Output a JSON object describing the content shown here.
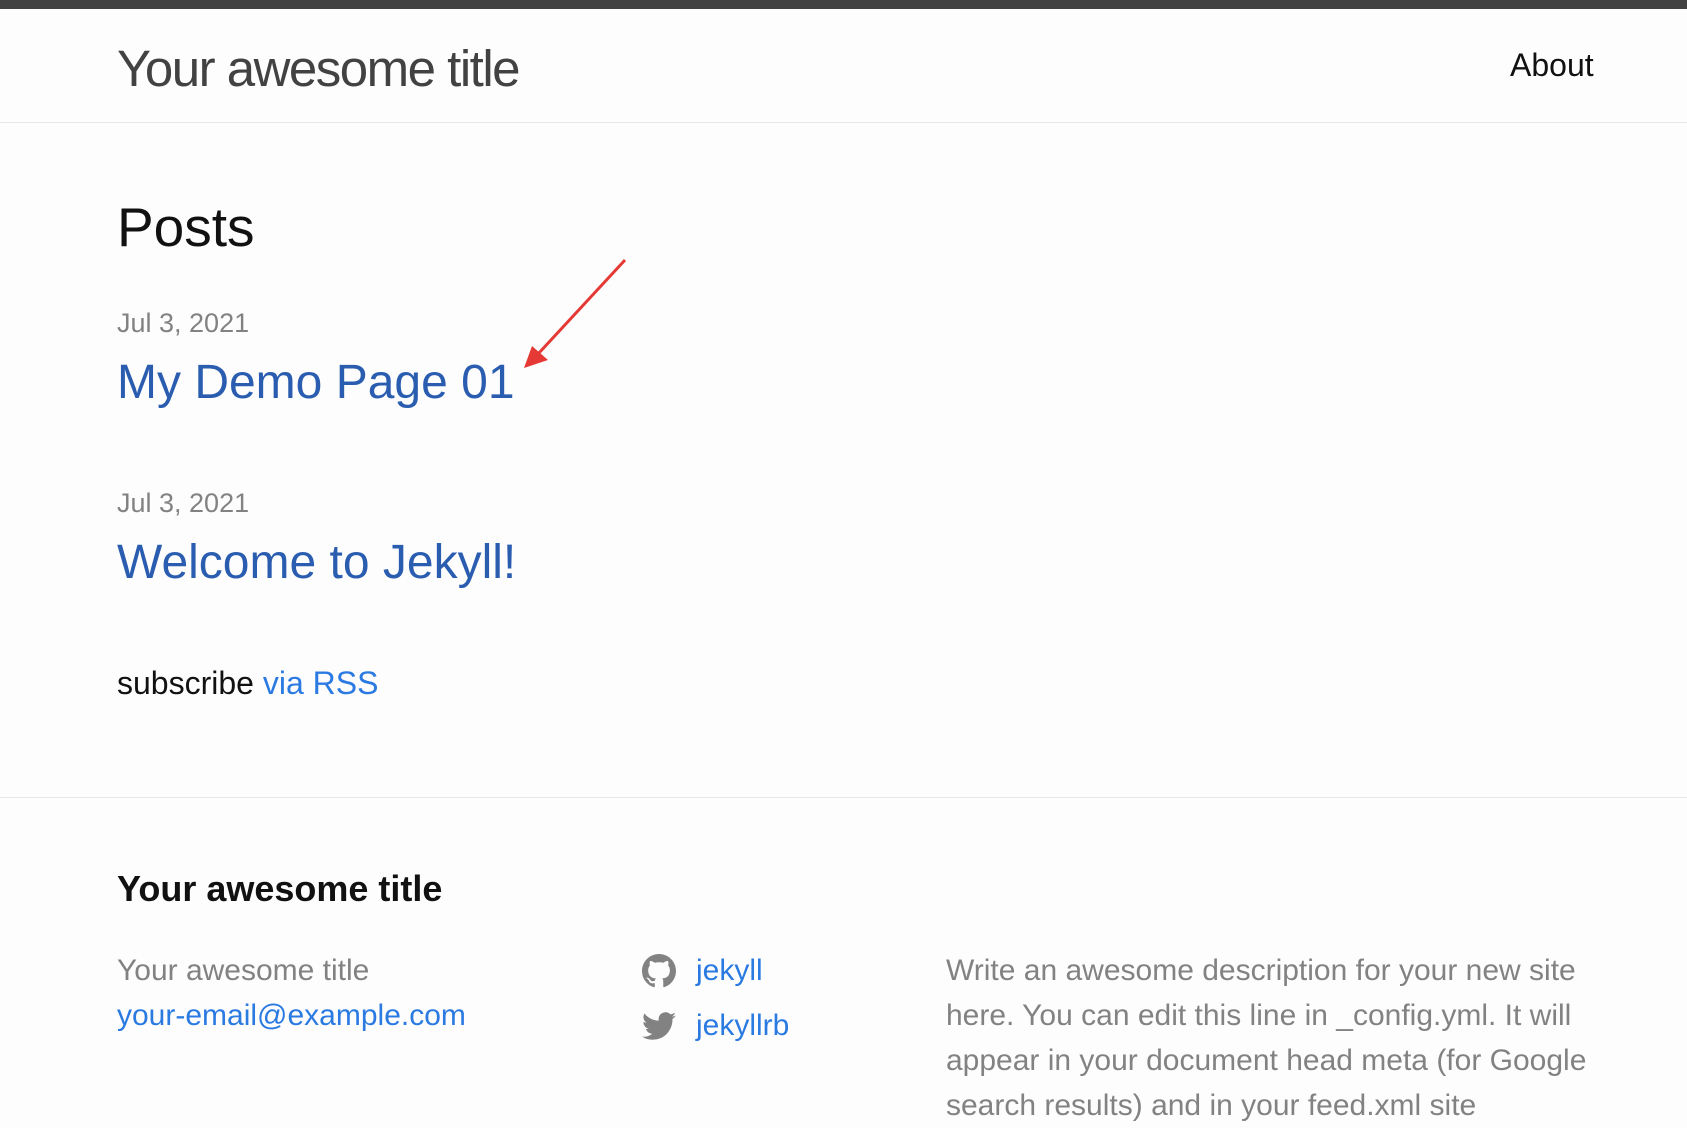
{
  "header": {
    "site_title": "Your awesome title",
    "nav": {
      "about": "About"
    }
  },
  "main": {
    "heading": "Posts",
    "posts": [
      {
        "date": "Jul 3, 2021",
        "title": "My Demo Page 01"
      },
      {
        "date": "Jul 3, 2021",
        "title": "Welcome to Jekyll!"
      }
    ],
    "subscribe": {
      "text": "subscribe",
      "link": "via RSS"
    }
  },
  "footer": {
    "heading": "Your awesome title",
    "contact": {
      "name": "Your awesome title",
      "email": "your-email@example.com"
    },
    "social": [
      {
        "icon": "github-icon",
        "label": "jekyll"
      },
      {
        "icon": "twitter-icon",
        "label": "jekyllrb"
      }
    ],
    "description": "Write an awesome description for your new site here. You can edit this line in _config.yml. It will appear in your document head meta (for Google search results) and in your feed.xml site"
  },
  "colors": {
    "link": "#2a7ae2",
    "post_link": "#2a5db0",
    "meta": "#828282",
    "annotation_arrow": "#e53935"
  }
}
